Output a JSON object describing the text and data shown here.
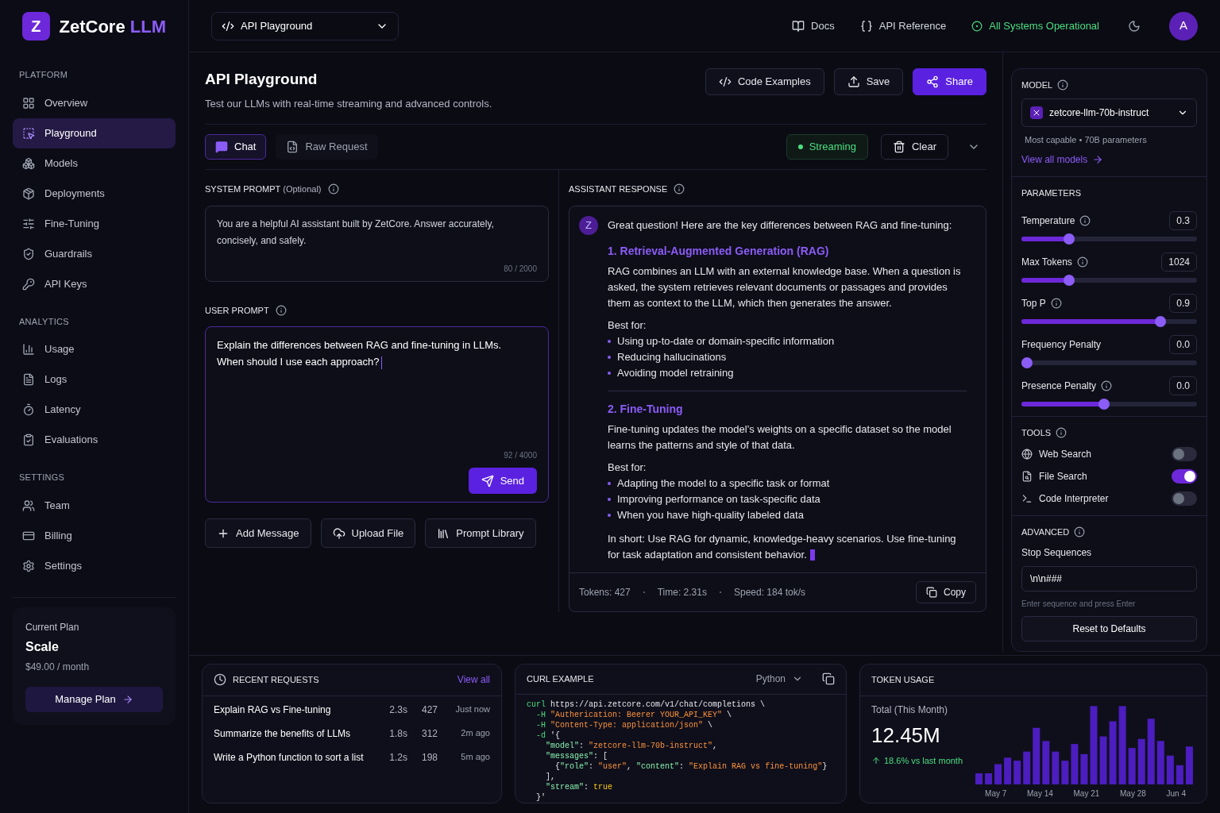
{
  "brand": {
    "logo_letter": "Z",
    "name": "ZetCore",
    "accent": "LLM"
  },
  "topbar": {
    "selector": "API Playground",
    "links": [
      "Docs",
      "API Reference"
    ],
    "status": "All Systems Operational",
    "avatar": "A"
  },
  "sidebar": {
    "sections": [
      {
        "title": "PLATFORM",
        "items": [
          {
            "label": "Overview",
            "selected": false
          },
          {
            "label": "Playground",
            "selected": true
          },
          {
            "label": "Models",
            "selected": false
          },
          {
            "label": "Deployments",
            "selected": false
          },
          {
            "label": "Fine-Tuning",
            "selected": false
          },
          {
            "label": "Guardrails",
            "selected": false
          },
          {
            "label": "API Keys",
            "selected": false
          }
        ]
      },
      {
        "title": "ANALYTICS",
        "items": [
          {
            "label": "Usage",
            "selected": false
          },
          {
            "label": "Logs",
            "selected": false
          },
          {
            "label": "Latency",
            "selected": false
          },
          {
            "label": "Evaluations",
            "selected": false
          }
        ]
      },
      {
        "title": "SETTINGS",
        "items": [
          {
            "label": "Team",
            "selected": false
          },
          {
            "label": "Billing",
            "selected": false
          },
          {
            "label": "Settings",
            "selected": false
          }
        ]
      }
    ]
  },
  "plan": {
    "label": "Current Plan",
    "name": "Scale",
    "price": "$49.00 / month",
    "button": "Manage Plan"
  },
  "page": {
    "title": "API Playground",
    "subtitle": "Test our LLMs with real-time streaming and advanced controls.",
    "actions": [
      {
        "label": "Code Examples",
        "kind": "outline"
      },
      {
        "label": "Save",
        "kind": "outline"
      },
      {
        "label": "Share",
        "kind": "primary"
      }
    ]
  },
  "tabs": [
    {
      "label": "Chat",
      "selected": true
    },
    {
      "label": "Raw Request",
      "selected": false
    }
  ],
  "streaming": {
    "label": "Streaming",
    "on": true
  },
  "clear": "Clear",
  "system_prompt": {
    "title": "SYSTEM PROMPT",
    "note": "(Optional)",
    "value": "You are a helpful AI assistant built by ZetCore. Answer accurately, concisely, and safely.",
    "count": "80 / 2000"
  },
  "user_prompt": {
    "title": "USER PROMPT",
    "value": "Explain the differences between RAG and fine-tuning in LLMs.\nWhen should I use each approach?",
    "count": "92 / 4000",
    "send": "Send"
  },
  "prompt_actions": [
    "Add Message",
    "Upload File",
    "Prompt Library"
  ],
  "response": {
    "title": "ASSISTANT RESPONSE",
    "avatar": "Z",
    "intro": "Great question! Here are the key differences between RAG and fine-tuning:",
    "sections": [
      {
        "heading": "1. Retrieval-Augmented Generation (RAG)",
        "body": "RAG combines an LLM with an external knowledge base. When a question is asked, the system retrieves relevant documents or passages and provides them as context to the LLM, which then generates the answer.",
        "label": "Best for:",
        "bullets": [
          "Using up-to-date or domain-specific information",
          "Reducing hallucinations",
          "Avoiding model retraining"
        ]
      },
      {
        "heading": "2. Fine-Tuning",
        "body": "Fine-tuning updates the model’s weights on a specific dataset so the model learns the patterns and style of that data.",
        "label": "Best for:",
        "bullets": [
          "Adapting the model to a specific task or format",
          "Improving performance on task-specific data",
          "When you have high-quality labeled data"
        ]
      }
    ],
    "summary": "In short: Use RAG for dynamic, knowledge-heavy scenarios. Use fine-tuning for task adaptation and consistent behavior.",
    "cursor": true,
    "stats": [
      "Tokens: 427",
      "Time: 2.31s",
      "Speed: 184 tok/s"
    ],
    "copy": "Copy"
  },
  "model": {
    "title": "MODEL",
    "value": "zetcore-llm-70b-instruct",
    "hint": "Most capable • 70B parameters",
    "link": "View all models"
  },
  "parameters": {
    "title": "PARAMETERS",
    "items": [
      {
        "label": "Temperature",
        "value": "0.3",
        "level": 0.27,
        "info": true
      },
      {
        "label": "Max Tokens",
        "value": "1024",
        "level": 0.27,
        "info": true
      },
      {
        "label": "Top P",
        "value": "0.9",
        "level": 0.79,
        "info": true
      },
      {
        "label": "Frequency Penalty",
        "value": "0.0",
        "level": 0.02,
        "info": false
      },
      {
        "label": "Presence Penalty",
        "value": "0.0",
        "level": 0.47,
        "info": true
      }
    ]
  },
  "tools": {
    "title": "TOOLS",
    "items": [
      {
        "label": "Web Search",
        "on": false
      },
      {
        "label": "File Search",
        "on": true
      },
      {
        "label": "Code Interpreter",
        "on": false
      }
    ]
  },
  "advanced": {
    "title": "ADVANCED",
    "field_label": "Stop Sequences",
    "value": "\\n\\n###",
    "hint": "Enter sequence and press Enter",
    "reset": "Reset to Defaults"
  },
  "recent": {
    "title": "RECENT REQUESTS",
    "link": "View all",
    "rows": [
      {
        "title": "Explain RAG vs Fine-tuning",
        "time": "2.3s",
        "tokens": "427",
        "ago": "Just now"
      },
      {
        "title": "Summarize the benefits of LLMs",
        "time": "1.8s",
        "tokens": "312",
        "ago": "2m ago"
      },
      {
        "title": "Write a Python function to sort a list",
        "time": "1.2s",
        "tokens": "198",
        "ago": "5m ago"
      }
    ]
  },
  "curl": {
    "title": "CURL EXAMPLE",
    "language": "Python",
    "lines": [
      [
        {
          "kind": "cmd",
          "text": "curl"
        },
        {
          "kind": "plain",
          "text": " https://api.zetcore.com/v1/chat/completions \\"
        }
      ],
      [
        {
          "kind": "cmd",
          "text": "  -H"
        },
        {
          "kind": "string",
          "text": " \"Autherication: Beerer YOUR_API_KEY\""
        },
        {
          "kind": "plain",
          "text": " \\"
        }
      ],
      [
        {
          "kind": "cmd",
          "text": "  -H"
        },
        {
          "kind": "string",
          "text": " \"Content-Type: application/json\""
        },
        {
          "kind": "plain",
          "text": " \\"
        }
      ],
      [
        {
          "kind": "cmd",
          "text": "  -d"
        },
        {
          "kind": "plain",
          "text": " '{"
        }
      ],
      [
        {
          "kind": "key",
          "text": "    \"model\""
        },
        {
          "kind": "plain",
          "text": ": "
        },
        {
          "kind": "string",
          "text": "\"zetcore-llm-70b-instruct\""
        },
        {
          "kind": "plain",
          "text": ","
        }
      ],
      [
        {
          "kind": "key",
          "text": "    \"messages\""
        },
        {
          "kind": "plain",
          "text": ": ["
        }
      ],
      [
        {
          "kind": "plain",
          "text": "      {"
        },
        {
          "kind": "key",
          "text": "\"role\""
        },
        {
          "kind": "plain",
          "text": ": "
        },
        {
          "kind": "string",
          "text": "\"user\""
        },
        {
          "kind": "plain",
          "text": ", "
        },
        {
          "kind": "key",
          "text": "\"content\""
        },
        {
          "kind": "plain",
          "text": ": "
        },
        {
          "kind": "string",
          "text": "\"Explain RAG vs fine-tuning\""
        },
        {
          "kind": "plain",
          "text": "}"
        }
      ],
      [
        {
          "kind": "plain",
          "text": "    ],"
        }
      ],
      [
        {
          "kind": "key",
          "text": "    \"stream\""
        },
        {
          "kind": "plain",
          "text": ": "
        },
        {
          "kind": "literal",
          "text": "true"
        }
      ],
      [
        {
          "kind": "plain",
          "text": "  }'"
        }
      ]
    ]
  },
  "usage": {
    "title": "TOKEN USAGE",
    "label": "Total (This Month)",
    "value": "12.45M",
    "change": "18.6% vs last month",
    "x_labels": [
      "May 7",
      "May 14",
      "May 21",
      "May 28",
      "Jun 4"
    ]
  }
}
